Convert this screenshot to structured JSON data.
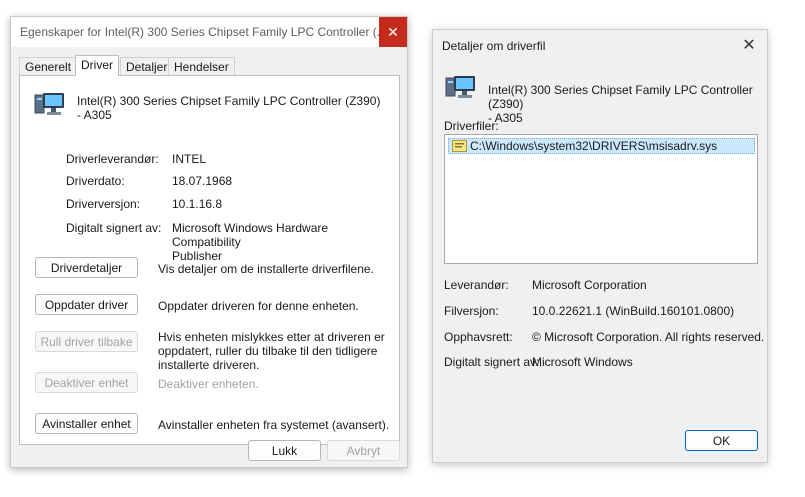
{
  "properties_dialog": {
    "title": "Egenskaper for Intel(R) 300 Series Chipset Family LPC Controller (...",
    "close_glyph": "✕",
    "tabs": [
      {
        "label": "Generelt"
      },
      {
        "label": "Driver"
      },
      {
        "label": "Detaljer"
      },
      {
        "label": "Hendelser"
      }
    ],
    "active_tab": "Driver",
    "device_name_line1": "Intel(R) 300 Series Chipset Family LPC Controller (Z390)",
    "device_name_line2": "- A305",
    "fields": {
      "provider_label": "Driverleverandør:",
      "provider_value": "INTEL",
      "date_label": "Driverdato:",
      "date_value": "18.07.1968",
      "version_label": "Driverversjon:",
      "version_value": "10.1.16.8",
      "signer_label": "Digitalt signert av:",
      "signer_value_line1": "Microsoft Windows Hardware Compatibility",
      "signer_value_line2": "Publisher"
    },
    "actions": {
      "details_button": "Driverdetaljer",
      "details_desc": "Vis detaljer om de installerte driverfilene.",
      "update_button": "Oppdater driver",
      "update_desc": "Oppdater driveren for denne enheten.",
      "rollback_button": "Rull driver tilbake",
      "rollback_desc_line1": "Hvis enheten mislykkes etter at driveren er",
      "rollback_desc_line2": "oppdatert, ruller du tilbake til den tidligere",
      "rollback_desc_line3": "installerte driveren.",
      "disable_button": "Deaktiver enhet",
      "disable_desc": "Deaktiver enheten.",
      "uninstall_button": "Avinstaller enhet",
      "uninstall_desc": "Avinstaller enheten fra systemet (avansert)."
    },
    "footer": {
      "close_button": "Lukk",
      "cancel_button": "Avbryt"
    }
  },
  "driver_file_dialog": {
    "title": "Detaljer om driverfil",
    "close_glyph": "✕",
    "device_name_line1": "Intel(R) 300 Series Chipset Family LPC Controller (Z390)",
    "device_name_line2": "- A305",
    "files_label": "Driverfiler:",
    "files": [
      "C:\\Windows\\system32\\DRIVERS\\msisadrv.sys"
    ],
    "provider_label": "Leverandør:",
    "provider_value": "Microsoft Corporation",
    "version_label": "Filversjon:",
    "version_value": "10.0.22621.1 (WinBuild.160101.0800)",
    "copyright_label": "Opphavsrett:",
    "copyright_value": "© Microsoft Corporation. All rights reserved.",
    "signer_label": "Digitalt signert av:",
    "signer_value": "Microsoft Windows",
    "ok_button": "OK"
  },
  "icons": {
    "device": "computer-device-icon",
    "file": "driver-file-icon",
    "close": "close-icon"
  },
  "colors": {
    "close_hover_red": "#c42b1c",
    "selection_blue": "#cce8ff",
    "default_button_border": "#0067c0"
  }
}
